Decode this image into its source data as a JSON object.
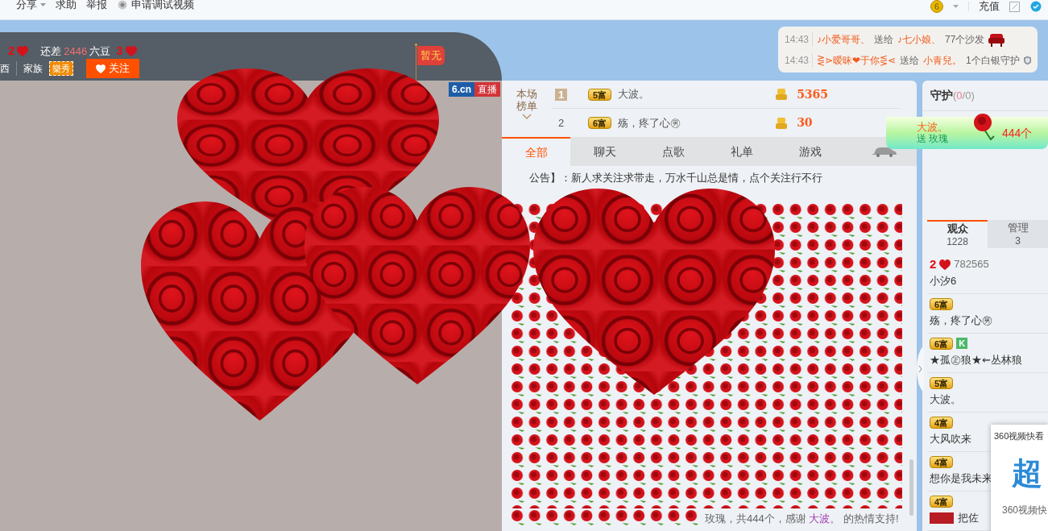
{
  "toolbar": {
    "left": [
      {
        "label": "分享",
        "kind": "dropdown"
      },
      {
        "label": "求助",
        "kind": "link"
      },
      {
        "label": "举报",
        "kind": "link"
      },
      {
        "label": "申请调试视频",
        "kind": "camera"
      }
    ],
    "coin": "6",
    "recharge": "充值"
  },
  "streamer": {
    "level": "2",
    "gap_label": "还差",
    "gap_amount": "2446",
    "gap_unit": "六豆",
    "next_level": "3",
    "place": "西",
    "family_label": "家族",
    "family_tag": "樂秀",
    "follow": "关注",
    "flag": "暂无"
  },
  "video": {
    "brand": "6.cn",
    "live": "直播"
  },
  "gift_feed": [
    {
      "time": "14:43",
      "sender": "♪小爱哥哥、",
      "verb": "送给",
      "receiver": "♪七小娘、",
      "gift": "77个沙发",
      "kind": "sofa"
    },
    {
      "time": "14:43",
      "sender": "⋛⋗暧昧❤于你⋚⋖",
      "verb": "送给",
      "receiver": "小青兒。",
      "gift": "1个白银守护",
      "kind": "shield"
    }
  ],
  "ranking": {
    "title": "本场榜单",
    "rows": [
      {
        "rank": "1",
        "highlighted": true,
        "badge": "5富",
        "name": "大波。",
        "amount": "5365"
      },
      {
        "rank": "2",
        "highlighted": false,
        "badge": "6富",
        "name": "殇，疼了心㊚",
        "amount": "30"
      }
    ]
  },
  "chat_tabs": [
    {
      "label": "全部",
      "selected": true
    },
    {
      "label": "聊天",
      "selected": false
    },
    {
      "label": "点歌",
      "selected": false
    },
    {
      "label": "礼单",
      "selected": false
    },
    {
      "label": "游戏",
      "selected": false
    }
  ],
  "announcement": "公告】：新人求关注求带走，万水千山总是情，点个关注行不行",
  "gift_message": {
    "prefix": "玫瑰，共444个，感谢",
    "user": "大波。",
    "suffix": "的热情支持!"
  },
  "guard": {
    "title": "守护",
    "count_parts": [
      "(",
      "0",
      "/0)"
    ]
  },
  "gift_banner": {
    "sender": "大波。",
    "action": "送 玫瑰",
    "amount": "444个"
  },
  "audience_tabs": [
    {
      "label": "观众",
      "count": "1228",
      "selected": true
    },
    {
      "label": "管理",
      "count": "3",
      "selected": false
    }
  ],
  "audience": [
    {
      "kind": "heart_level",
      "level": "2",
      "number": "782565",
      "name": "小汐6"
    },
    {
      "kind": "wealth",
      "badge": "6富",
      "name": "殇，疼了心㊚"
    },
    {
      "kind": "wealth",
      "badge": "6富",
      "extra": "K",
      "name": "★孤㊣狼★⇜丛林狼"
    },
    {
      "kind": "wealth",
      "badge": "5富",
      "name": "大波。"
    },
    {
      "kind": "wealth",
      "badge": "4富",
      "name": "大风吹来"
    },
    {
      "kind": "wealth",
      "badge": "4富",
      "name": "想你是我未来"
    },
    {
      "kind": "wealth_tag",
      "badge": "4富",
      "name": "把佐"
    }
  ],
  "popup": {
    "title": "360视频快看",
    "logo": "超",
    "footer": "360视频快"
  }
}
